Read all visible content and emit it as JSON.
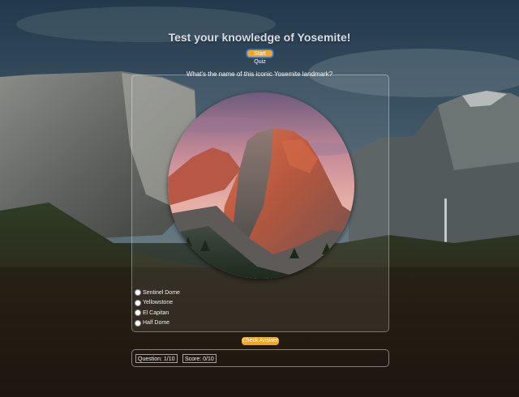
{
  "page": {
    "title": "Test your knowledge of Yosemite!",
    "start_button": "Start Quiz"
  },
  "quiz": {
    "question": "What's the name of this iconic Yosemite landmark?",
    "options": [
      {
        "label": "Sentinel Dome"
      },
      {
        "label": "Yellowstone"
      },
      {
        "label": "El Capitan"
      },
      {
        "label": "Half Dome"
      }
    ],
    "check_button": "Check Answer"
  },
  "status": {
    "question_counter": "Question: 1/10",
    "score": "Score: 0/10"
  },
  "colors": {
    "accent": "#f2a623",
    "text": "#f2f2f2",
    "title": "#d9dde2"
  }
}
